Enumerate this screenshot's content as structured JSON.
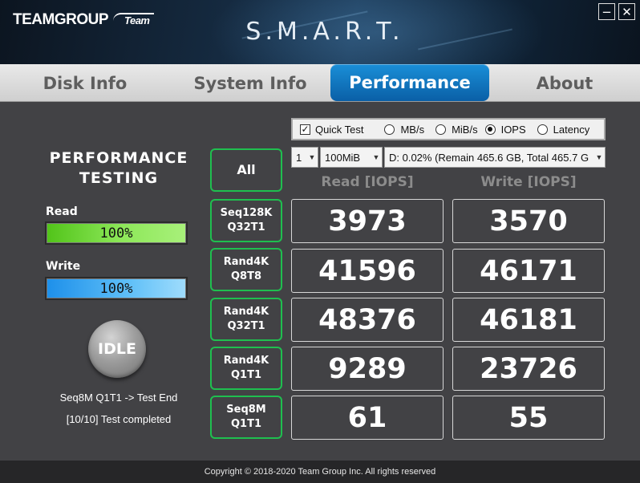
{
  "header": {
    "brand": "TEAMGROUP",
    "brand_badge": "Team",
    "title": "S.M.A.R.T.",
    "minimize_symbol": "−",
    "close_symbol": "✕"
  },
  "tabs": [
    {
      "label": "Disk Info",
      "active": false
    },
    {
      "label": "System Info",
      "active": false
    },
    {
      "label": "Performance",
      "active": true
    },
    {
      "label": "About",
      "active": false
    }
  ],
  "left_panel": {
    "title_line1": "PERFORMANCE",
    "title_line2": "TESTING",
    "read_label": "Read",
    "read_percent": "100%",
    "read_progress": 1.0,
    "write_label": "Write",
    "write_percent": "100%",
    "write_progress": 1.0,
    "idle_label": "IDLE",
    "status_line1": "Seq8M Q1T1 -> Test End",
    "status_line2": "[10/10] Test completed"
  },
  "options": {
    "quick_test_label": "Quick Test",
    "quick_test_checked": true,
    "units": [
      {
        "label": "MB/s",
        "selected": false
      },
      {
        "label": "MiB/s",
        "selected": false
      },
      {
        "label": "IOPS",
        "selected": true
      },
      {
        "label": "Latency",
        "selected": false
      }
    ],
    "count_value": "1",
    "size_value": "100MiB",
    "drive_value": "D:  0.02% (Remain 465.6 GB, Total 465.7 G"
  },
  "results": {
    "all_label": "All",
    "read_header": "Read [IOPS]",
    "write_header": "Write [IOPS]",
    "rows": [
      {
        "line1": "Seq128K",
        "line2": "Q32T1",
        "read": "3973",
        "write": "3570"
      },
      {
        "line1": "Rand4K",
        "line2": "Q8T8",
        "read": "41596",
        "write": "46171"
      },
      {
        "line1": "Rand4K",
        "line2": "Q32T1",
        "read": "48376",
        "write": "46181"
      },
      {
        "line1": "Rand4K",
        "line2": "Q1T1",
        "read": "9289",
        "write": "23726"
      },
      {
        "line1": "Seq8M",
        "line2": "Q1T1",
        "read": "61",
        "write": "55"
      }
    ]
  },
  "footer": {
    "copyright": "Copyright © 2018-2020 Team Group Inc. All rights reserved"
  },
  "colors": {
    "accent_blue": "#0a7fd0",
    "test_border_green": "#1fbf4f",
    "read_bar_green": "#7ee050",
    "write_bar_blue": "#40b4f5",
    "panel_bg": "#424245"
  }
}
